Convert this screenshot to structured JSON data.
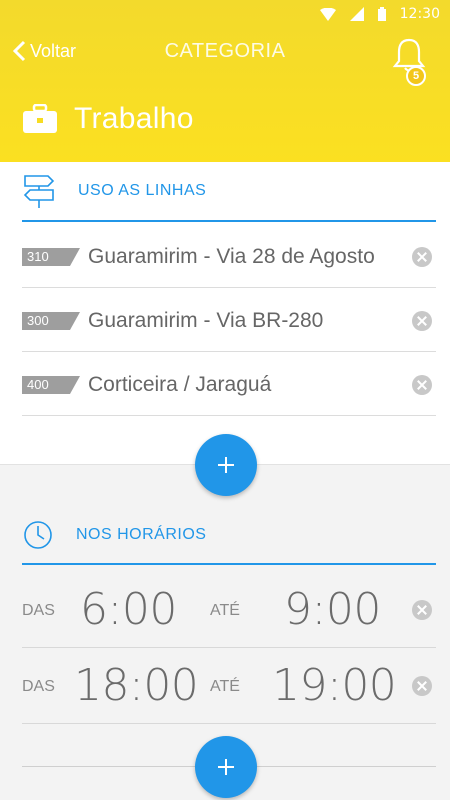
{
  "status": {
    "time": "12:30"
  },
  "nav": {
    "back_label": "Voltar",
    "title": "CATEGORIA",
    "badge_count": "5"
  },
  "category": {
    "label": "Trabalho",
    "icon": "briefcase-icon"
  },
  "lines_section": {
    "title": "USO AS LINHAS",
    "items": [
      {
        "number": "310",
        "name": "Guaramirim - Via 28 de Agosto"
      },
      {
        "number": "300",
        "name": "Guaramirim - Via BR-280"
      },
      {
        "number": "400",
        "name": "Corticeira / Jaraguá"
      }
    ]
  },
  "hours_section": {
    "title": "NOS HORÁRIOS",
    "from_label": "DAS",
    "to_label": "ATÉ",
    "items": [
      {
        "from": "6:00",
        "to": "9:00"
      },
      {
        "from": "18:00",
        "to": "19:00"
      }
    ]
  },
  "colors": {
    "header": "#f7dc22",
    "accent": "#2196e8"
  }
}
